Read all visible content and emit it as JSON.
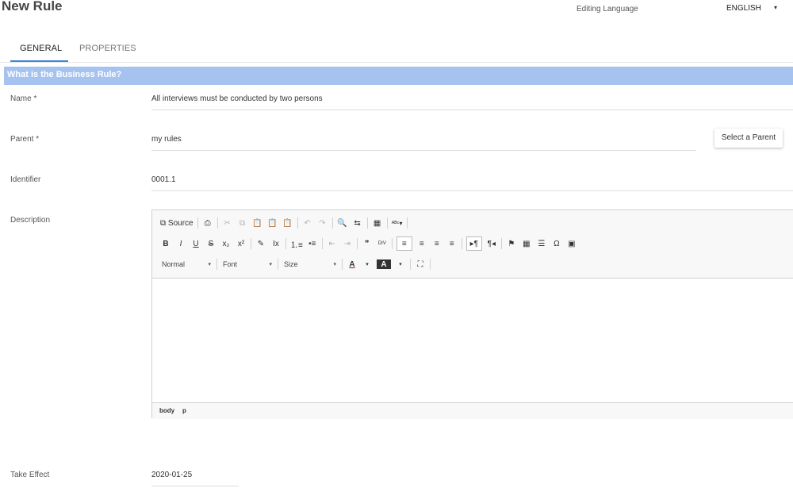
{
  "header": {
    "title": "New Rule",
    "editing_language_label": "Editing Language",
    "language_value": "ENGLISH",
    "caret": "▾"
  },
  "tabs": [
    {
      "label": "GENERAL",
      "active": true
    },
    {
      "label": "PROPERTIES",
      "active": false
    }
  ],
  "section": {
    "title": "What is the Business Rule?"
  },
  "fields": {
    "name": {
      "label": "Name *",
      "value": "All interviews must be conducted by two persons"
    },
    "parent": {
      "label": "Parent  *",
      "value": "my rules",
      "button": "Select a Parent"
    },
    "identifier": {
      "label": "Identifier",
      "value": "0001.1"
    },
    "description": {
      "label": "Description"
    },
    "take_effect": {
      "label": "Take Effect",
      "value": "2020-01-25"
    }
  },
  "editor": {
    "row1": [
      {
        "name": "source-button",
        "text": "⧉ Source"
      },
      {
        "sep": true
      },
      {
        "name": "print-icon",
        "text": "⎙"
      },
      {
        "sep": true
      },
      {
        "name": "cut-icon",
        "text": "✂",
        "dim": true
      },
      {
        "name": "copy-icon",
        "text": "⧉",
        "dim": true
      },
      {
        "name": "paste-icon",
        "text": "📋"
      },
      {
        "name": "paste-text-icon",
        "text": "📋"
      },
      {
        "name": "paste-word-icon",
        "text": "📋"
      },
      {
        "sep": true
      },
      {
        "name": "undo-icon",
        "text": "↶",
        "dim": true
      },
      {
        "name": "redo-icon",
        "text": "↷",
        "dim": true
      },
      {
        "sep": true
      },
      {
        "name": "find-icon",
        "text": "🔍"
      },
      {
        "name": "replace-icon",
        "text": "⇆"
      },
      {
        "sep": true
      },
      {
        "name": "select-all-icon",
        "text": "▦"
      },
      {
        "sep": true
      },
      {
        "name": "spellcheck-icon",
        "text": "ᴬᴮᶜ▾"
      },
      {
        "sep": true
      }
    ],
    "row2": [
      {
        "name": "bold-icon",
        "text": "B"
      },
      {
        "name": "italic-icon",
        "text": "I"
      },
      {
        "name": "underline-icon",
        "text": "U"
      },
      {
        "name": "strikethrough-icon",
        "text": "S"
      },
      {
        "name": "subscript-icon",
        "text": "x₂"
      },
      {
        "name": "superscript-icon",
        "text": "x²"
      },
      {
        "sep": true
      },
      {
        "name": "copy-format-icon",
        "text": "✎"
      },
      {
        "name": "remove-format-icon",
        "text": "Ix"
      },
      {
        "sep": true
      },
      {
        "name": "numbered-list-icon",
        "text": "⒈≡"
      },
      {
        "name": "bulleted-list-icon",
        "text": "•≡"
      },
      {
        "sep": true
      },
      {
        "name": "decrease-indent-icon",
        "text": "⇤",
        "dim": true
      },
      {
        "name": "increase-indent-icon",
        "text": "⇥",
        "dim": true
      },
      {
        "sep": true
      },
      {
        "name": "blockquote-icon",
        "text": "❞"
      },
      {
        "name": "div-container-icon",
        "text": "DIV"
      },
      {
        "sep": true
      },
      {
        "name": "align-left-icon",
        "text": "≡",
        "active": true
      },
      {
        "name": "align-center-icon",
        "text": "≡"
      },
      {
        "name": "align-right-icon",
        "text": "≡"
      },
      {
        "name": "justify-icon",
        "text": "≡"
      },
      {
        "sep": true
      },
      {
        "name": "ltr-icon",
        "text": "▸¶",
        "active": true
      },
      {
        "name": "rtl-icon",
        "text": "¶◂"
      },
      {
        "sep": true
      },
      {
        "name": "anchor-icon",
        "text": "⚑"
      },
      {
        "name": "table-icon",
        "text": "▦"
      },
      {
        "name": "horizontal-line-icon",
        "text": "☰"
      },
      {
        "name": "special-char-icon",
        "text": "Ω"
      },
      {
        "name": "image-icon",
        "text": "▣"
      }
    ],
    "row3": {
      "format_combo": "Normal",
      "font_combo": "Font",
      "size_combo": "Size",
      "text_color": "A",
      "bg_color": "A",
      "maximize": "⛶"
    },
    "footer_path": [
      "body",
      "p"
    ]
  },
  "colors": {
    "accent": "#3f88d8",
    "section_bar": "#a6c3f0"
  }
}
